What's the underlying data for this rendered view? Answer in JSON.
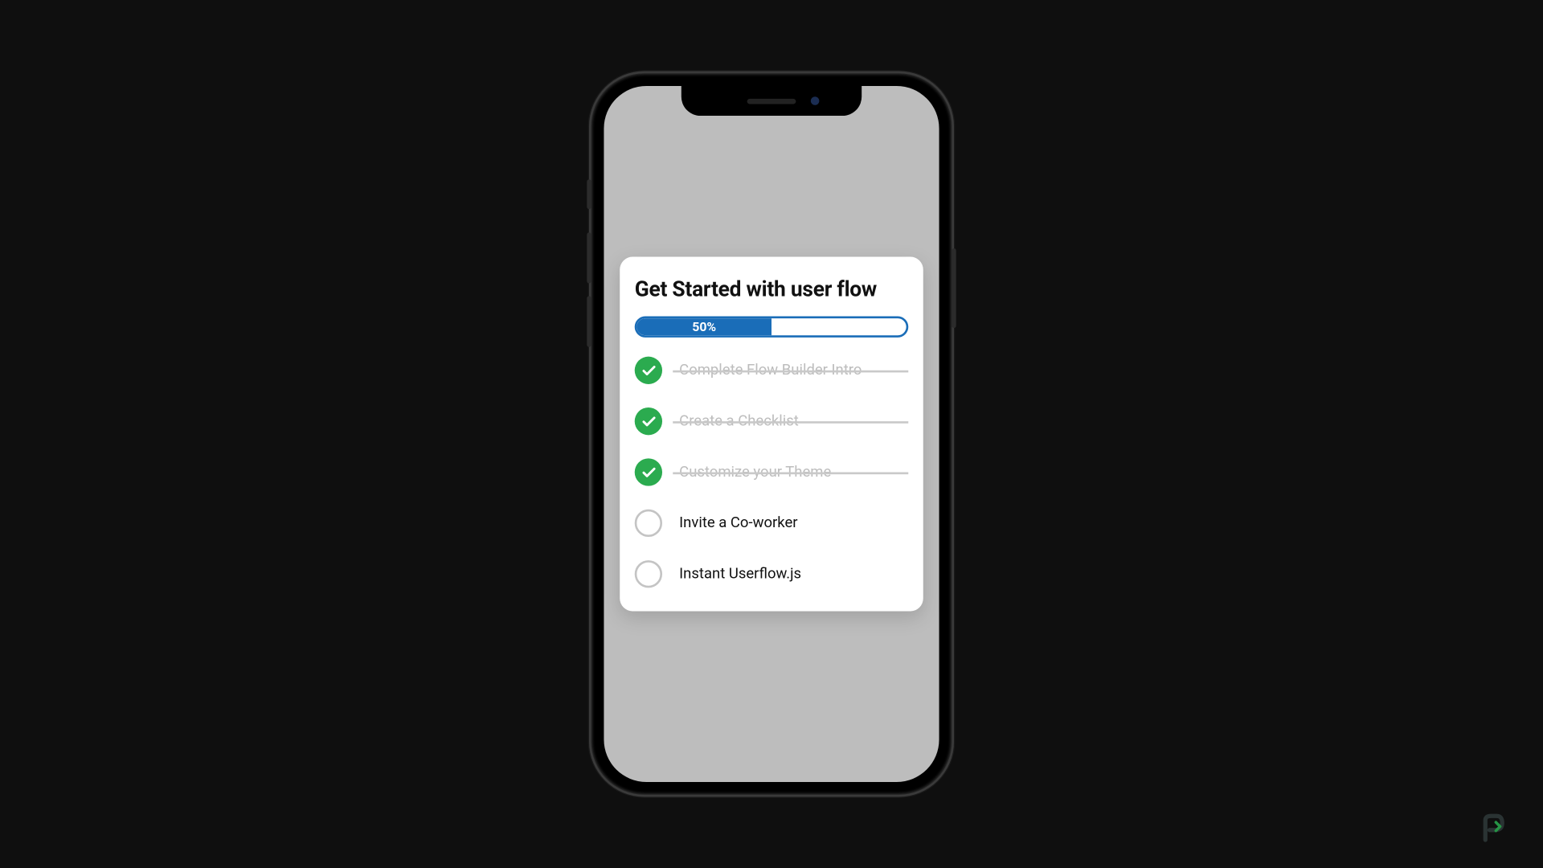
{
  "card": {
    "title": "Get Started with user flow",
    "progress_label": "50%",
    "progress_percent": 50
  },
  "checklist": [
    {
      "label": "Complete Flow Builder Intro",
      "done": true
    },
    {
      "label": "Create a Checklist",
      "done": true
    },
    {
      "label": "Customize your Theme",
      "done": true
    },
    {
      "label": "Invite a Co-worker",
      "done": false
    },
    {
      "label": "Instant Userflow.js",
      "done": false
    }
  ],
  "colors": {
    "accent": "#1a6db8",
    "success": "#2bab4f",
    "muted": "#bdbdbd"
  }
}
